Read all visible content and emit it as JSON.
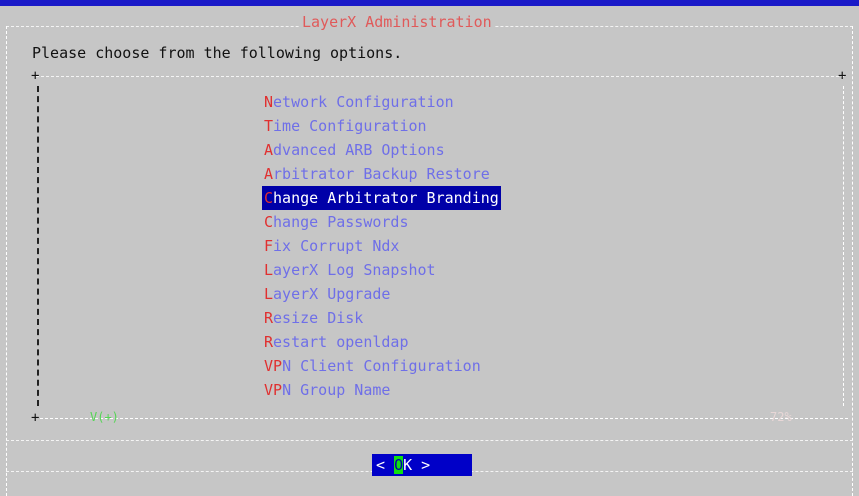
{
  "dialog": {
    "title": "LayerX Administration",
    "prompt": "Please choose from the following options."
  },
  "menu": {
    "items": [
      {
        "hot": "N",
        "rest": "etwork Configuration",
        "selected": false
      },
      {
        "hot": "T",
        "rest": "ime Configuration",
        "selected": false
      },
      {
        "hot": "A",
        "rest": "dvanced ARB Options",
        "selected": false
      },
      {
        "hot": "A",
        "rest": "rbitrator Backup Restore",
        "selected": false
      },
      {
        "hot": "C",
        "rest": "hange Arbitrator Branding",
        "selected": true
      },
      {
        "hot": "C",
        "rest": "hange Passwords",
        "selected": false
      },
      {
        "hot": "F",
        "rest": "ix Corrupt Ndx",
        "selected": false
      },
      {
        "hot": "L",
        "rest": "ayerX Log Snapshot",
        "selected": false
      },
      {
        "hot": "L",
        "rest": "ayerX Upgrade",
        "selected": false
      },
      {
        "hot": "R",
        "rest": "esize Disk",
        "selected": false
      },
      {
        "hot": "R",
        "rest": "estart openldap",
        "selected": false
      },
      {
        "hot": "VP",
        "rest": "N Client Configuration",
        "selected": false
      },
      {
        "hot": "VP",
        "rest": "N Group Name",
        "selected": false
      }
    ]
  },
  "status": {
    "scroll_indicator": "V(+)",
    "percent": "72%"
  },
  "buttons": {
    "ok_left": "< ",
    "ok_hot": "O",
    "ok_rest": "K >"
  },
  "colors": {
    "background": "#c6c6c6",
    "title": "#e05a5a",
    "item_text": "#6f6fe8",
    "hotkey": "#e03030",
    "selection": "#0000a8",
    "button": "#0000c8"
  }
}
